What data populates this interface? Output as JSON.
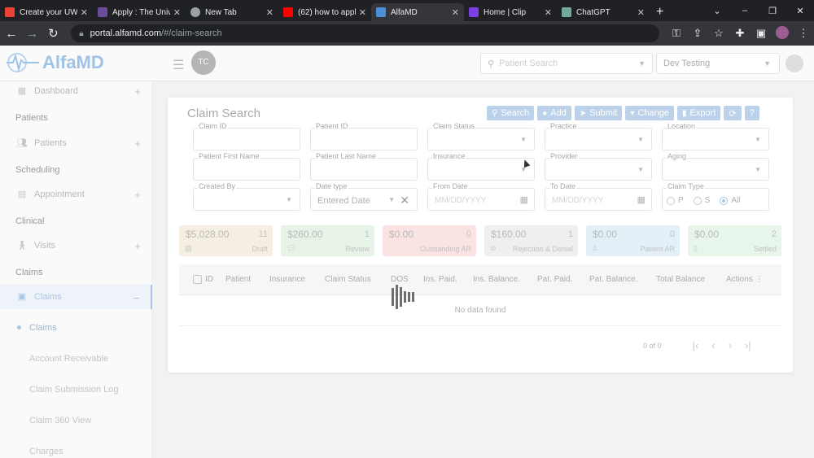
{
  "browser": {
    "tabs": [
      {
        "title": "Create your UW",
        "color": "#ea4335"
      },
      {
        "title": "Apply : The Univ",
        "color": "#6b4c9a"
      },
      {
        "title": "New Tab",
        "color": "#9aa0a6"
      },
      {
        "title": "(62) how to appl",
        "color": "#ff0000"
      },
      {
        "title": "AlfaMD",
        "color": "#4a90d9"
      },
      {
        "title": "Home | Clip",
        "color": "#7b3fe4"
      },
      {
        "title": "ChatGPT",
        "color": "#74aa9c"
      }
    ],
    "url_host": "portal.alfamd.com",
    "url_path": "/#/claim-search"
  },
  "app": {
    "logo_text": "AlfaMD",
    "user_initials": "TC",
    "patient_search_placeholder": "Patient Search",
    "org_select": "Dev Testing"
  },
  "sidebar": {
    "dashboard": "Dashboard",
    "sections": {
      "patients": "Patients",
      "scheduling": "Scheduling",
      "clinical": "Clinical",
      "claims": "Claims"
    },
    "items": {
      "patients": "Patients",
      "appointment": "Appointment",
      "visits": "Visits",
      "claims": "Claims"
    },
    "subitems": [
      "Claims",
      "Account Receivable",
      "Claim Submission Log",
      "Claim 360 View",
      "Charges"
    ]
  },
  "claim_search": {
    "title": "Claim Search",
    "buttons": {
      "search": "Search",
      "add": "Add",
      "submit": "Submit",
      "change": "Change",
      "export": "Export",
      "refresh": "⟳",
      "help": "?"
    },
    "fields": {
      "claim_id": "Claim ID",
      "patient_id": "Patient ID",
      "claim_status": "Claim Status",
      "practice": "Practice",
      "location": "Location",
      "patient_first_name": "Patient First Name",
      "patient_last_name": "Patient Last Name",
      "insurance": "Insurance",
      "provider": "Provider",
      "aging": "Aging",
      "created_by": "Created By",
      "date_type": "Date type",
      "date_type_value": "Entered Date",
      "from_date": "From Date",
      "to_date": "To Date",
      "date_placeholder": "MM/DD/YYYY",
      "claim_type": "Claim Type",
      "claim_type_options": [
        "P",
        "S",
        "All"
      ]
    },
    "stats": [
      {
        "amount": "$5,028.00",
        "count": "11",
        "label": "Draft",
        "color": "#f5efe3"
      },
      {
        "amount": "$260.00",
        "count": "1",
        "label": "Review",
        "color": "#e6f3e6"
      },
      {
        "amount": "$0.00",
        "count": "0",
        "label": "Outstanding AR",
        "color": "#fbe3e3"
      },
      {
        "amount": "$160.00",
        "count": "1",
        "label": "Rejection & Denial",
        "color": "#efefef"
      },
      {
        "amount": "$0.00",
        "count": "0",
        "label": "Patient AR",
        "color": "#e3f0f8"
      },
      {
        "amount": "$0.00",
        "count": "2",
        "label": "Settled",
        "color": "#e8f5ea"
      }
    ],
    "columns": [
      "ID",
      "Patient",
      "Insurance",
      "Claim Status",
      "DOS",
      "Ins. Paid.",
      "Ins. Balance.",
      "Pat. Paid.",
      "Pat. Balance.",
      "Total Balance",
      "Actions"
    ],
    "empty_text": "No data found",
    "pagination_text": "0 of 0"
  }
}
